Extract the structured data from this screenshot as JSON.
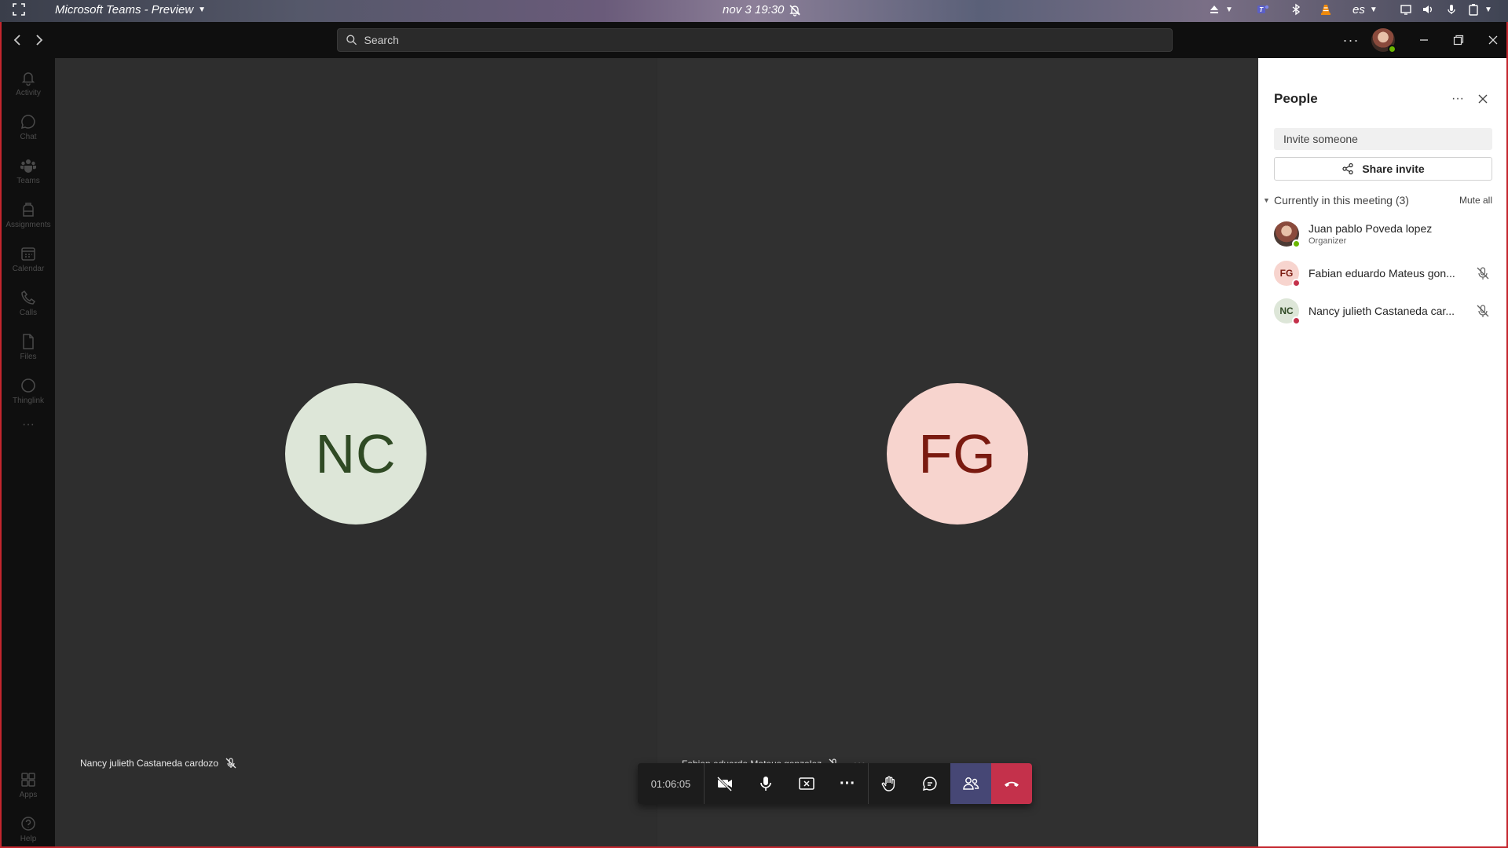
{
  "os_bar": {
    "app_title": "Microsoft Teams - Preview",
    "datetime": "nov 3  19:30",
    "language": "es"
  },
  "titlebar": {
    "search_placeholder": "Search"
  },
  "rail": {
    "items": [
      {
        "label": "Activity",
        "icon": "bell-icon"
      },
      {
        "label": "Chat",
        "icon": "chat-icon"
      },
      {
        "label": "Teams",
        "icon": "teams-icon"
      },
      {
        "label": "Assignments",
        "icon": "backpack-icon"
      },
      {
        "label": "Calendar",
        "icon": "calendar-icon"
      },
      {
        "label": "Calls",
        "icon": "phone-icon"
      },
      {
        "label": "Files",
        "icon": "file-icon"
      },
      {
        "label": "Thinglink",
        "icon": "circle-icon"
      }
    ],
    "more": "···",
    "apps": "Apps",
    "help": "Help"
  },
  "stage": {
    "left_tile": {
      "initials": "NC",
      "name": "Nancy julieth Castaneda cardozo",
      "avatar_bg": "#dde6d8",
      "avatar_fg": "#2f4a24"
    },
    "right_tile": {
      "initials": "FG",
      "name": "Fabian eduardo Mateus gonzalez",
      "avatar_bg": "#f7d4ce",
      "avatar_fg": "#7a1a10"
    }
  },
  "controls": {
    "timer": "01:06:05"
  },
  "panel": {
    "title": "People",
    "invite_placeholder": "Invite someone",
    "share_label": "Share invite",
    "section_label": "Currently in this meeting  (3)",
    "mute_all": "Mute all",
    "participants": [
      {
        "name": "Juan pablo Poveda lopez",
        "role": "Organizer",
        "initials": "",
        "status_color": "#6bb700"
      },
      {
        "name": "Fabian eduardo Mateus gon...",
        "role": "",
        "initials": "FG",
        "status_color": "#c4314b"
      },
      {
        "name": "Nancy julieth Castaneda car...",
        "role": "",
        "initials": "NC",
        "status_color": "#c4314b"
      }
    ]
  }
}
